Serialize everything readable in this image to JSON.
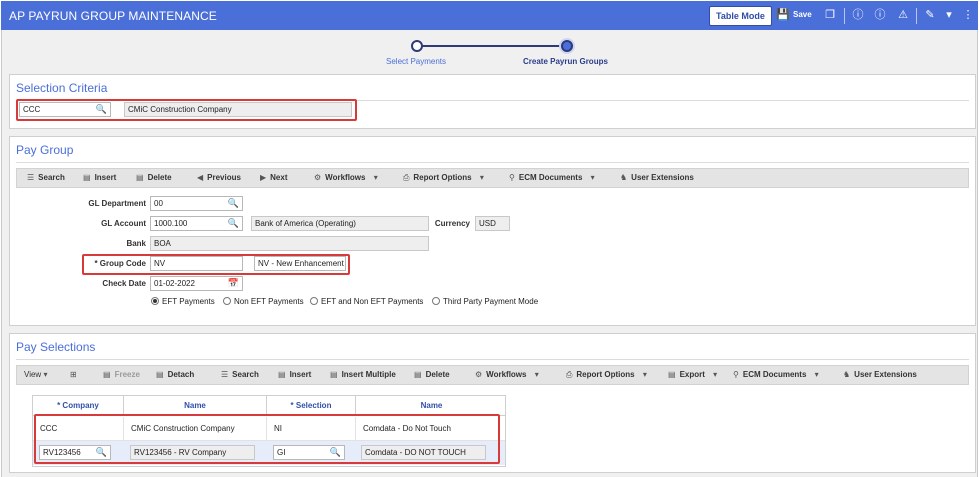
{
  "app": {
    "title": "AP PAYRUN GROUP MAINTENANCE",
    "table_mode_label": "Table Mode",
    "save_label": "Save"
  },
  "stepper": {
    "steps": [
      {
        "label": "Select Payments"
      },
      {
        "label": "Create Payrun Groups"
      }
    ],
    "active_index": 1
  },
  "selection_criteria": {
    "title": "Selection Criteria",
    "company_code": "CCC",
    "company_name": "CMiC Construction Company"
  },
  "pay_group": {
    "title": "Pay Group",
    "toolbar": [
      "Search",
      "Insert",
      "Delete",
      "Previous",
      "Next",
      "Workflows",
      "Report Options",
      "ECM Documents",
      "User Extensions"
    ],
    "fields": {
      "gl_department_label": "GL Department",
      "gl_department": "00",
      "gl_account_label": "GL Account",
      "gl_account": "1000.100",
      "gl_account_name": "Bank of America (Operating)",
      "currency_label": "Currency",
      "currency": "USD",
      "bank_label": "Bank",
      "bank": "BOA",
      "group_code_label": "* Group Code",
      "group_code": "NV",
      "group_code_desc": "NV - New Enhancement",
      "check_date_label": "Check Date",
      "check_date": "01-02-2022"
    },
    "payment_modes": [
      {
        "label": "EFT Payments",
        "selected": true
      },
      {
        "label": "Non EFT Payments",
        "selected": false
      },
      {
        "label": "EFT and Non EFT Payments",
        "selected": false
      },
      {
        "label": "Third Party Payment Mode",
        "selected": false
      }
    ]
  },
  "pay_selections": {
    "title": "Pay Selections",
    "toolbar": [
      "View",
      "Freeze",
      "Detach",
      "Search",
      "Insert",
      "Insert Multiple",
      "Delete",
      "Workflows",
      "Report Options",
      "Export",
      "ECM Documents",
      "User Extensions"
    ],
    "columns": [
      "* Company",
      "Name",
      "* Selection",
      "Name"
    ],
    "rows": [
      {
        "company": "CCC",
        "company_name": "CMiC Construction Company",
        "selection": "NI",
        "selection_name": "Comdata - Do Not Touch"
      },
      {
        "company": "RV123456",
        "company_name": "RV123456 - RV Company",
        "selection": "GI",
        "selection_name": "Comdata - DO NOT TOUCH"
      }
    ]
  },
  "colors": {
    "header_blue": "#4a6fd8",
    "highlight_red": "#d83a3a",
    "column_header_text": "#3350a8"
  }
}
